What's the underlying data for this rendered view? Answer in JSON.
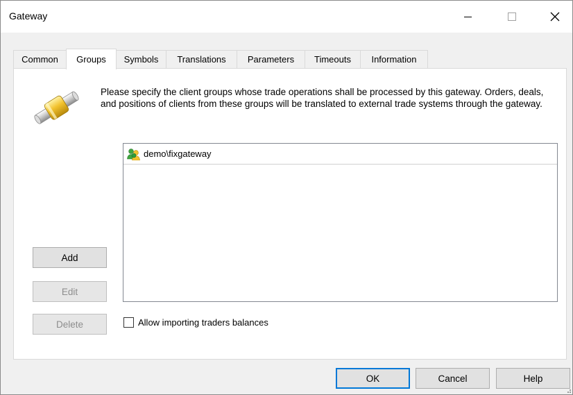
{
  "window": {
    "title": "Gateway"
  },
  "tabs": [
    {
      "label": "Common",
      "active": false
    },
    {
      "label": "Groups",
      "active": true
    },
    {
      "label": "Symbols",
      "active": false
    },
    {
      "label": "Translations",
      "active": false
    },
    {
      "label": "Parameters",
      "active": false
    },
    {
      "label": "Timeouts",
      "active": false
    },
    {
      "label": "Information",
      "active": false
    }
  ],
  "groups_page": {
    "description": "Please specify the client groups whose trade operations shall be processed by this gateway. Orders, deals, and positions of clients from these groups will be translated to external trade systems through the gateway.",
    "groups": [
      {
        "name": "demo\\fixgateway",
        "icon": "client-group-icon"
      }
    ],
    "buttons": {
      "add": "Add",
      "edit": "Edit",
      "delete": "Delete"
    },
    "checkbox": {
      "label": "Allow importing traders balances",
      "checked": false
    }
  },
  "footer": {
    "ok": "OK",
    "cancel": "Cancel",
    "help": "Help"
  },
  "colors": {
    "accent": "#0078d7",
    "icon_yellow": "#f2c22e",
    "icon_green": "#3fa53f"
  }
}
